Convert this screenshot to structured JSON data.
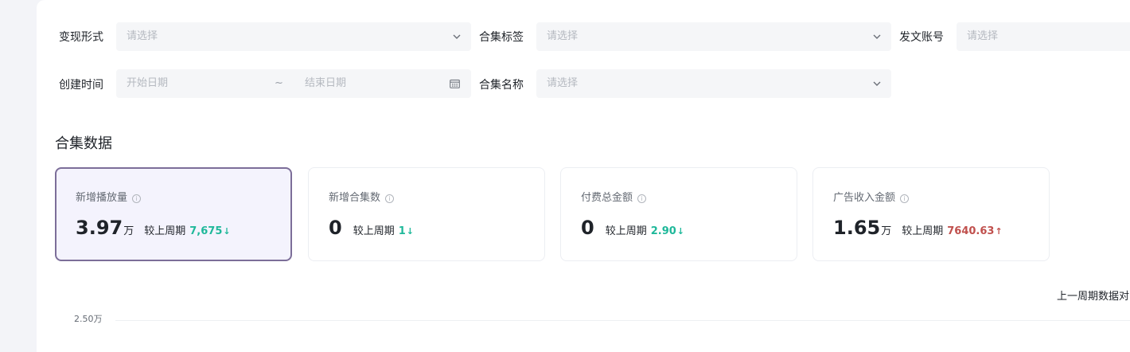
{
  "filters": {
    "monetization": {
      "label": "变现形式",
      "placeholder": "请选择"
    },
    "collection_tag": {
      "label": "合集标签",
      "placeholder": "请选择"
    },
    "post_account": {
      "label": "发文账号",
      "placeholder": "请选择"
    },
    "create_time": {
      "label": "创建时间",
      "start_placeholder": "开始日期",
      "separator": "~",
      "end_placeholder": "结束日期"
    },
    "collection_name": {
      "label": "合集名称",
      "placeholder": "请选择"
    }
  },
  "section": {
    "title": "合集数据"
  },
  "metrics": [
    {
      "label": "新增播放量",
      "value": "3.97",
      "unit": "万",
      "compare_label": "较上周期",
      "delta": "7,675",
      "trend": "down",
      "trend_arrow": "↓",
      "active": true
    },
    {
      "label": "新增合集数",
      "value": "0",
      "unit": "",
      "compare_label": "较上周期",
      "delta": "1",
      "trend": "down",
      "trend_arrow": "↓",
      "active": false
    },
    {
      "label": "付费总金额",
      "value": "0",
      "unit": "",
      "compare_label": "较上周期",
      "delta": "2.90",
      "trend": "down",
      "trend_arrow": "↓",
      "active": false
    },
    {
      "label": "广告收入金额",
      "value": "1.65",
      "unit": "万",
      "compare_label": "较上周期",
      "delta": "7640.63",
      "trend": "up",
      "trend_arrow": "↑",
      "active": false
    }
  ],
  "chart": {
    "legend_text": "上一周期数据对",
    "y_tick": "2.50万"
  },
  "colors": {
    "down": "#1fb89a",
    "up": "#c0504d",
    "active_border": "#7c6e99",
    "active_bg": "#f4f3fd"
  }
}
